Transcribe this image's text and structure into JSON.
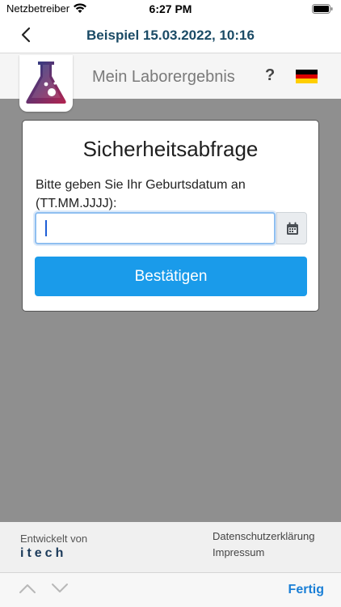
{
  "status_bar": {
    "carrier": "Netzbetreiber",
    "time": "6:27 PM"
  },
  "nav": {
    "title": "Beispiel 15.03.2022, 10:16"
  },
  "header": {
    "app_title": "Mein Laborergebnis",
    "help": "?"
  },
  "dialog": {
    "title": "Sicherheitsabfrage",
    "label": "Bitte geben Sie Ihr Geburtsdatum an (TT.MM.JJJJ):",
    "input_value": "",
    "confirm_label": "Bestätigen"
  },
  "footer": {
    "developed_by": "Entwickelt von",
    "developer_logo": "itech",
    "privacy": "Datenschutzerklärung",
    "imprint": "Impressum"
  },
  "keyboard_toolbar": {
    "done": "Fertig"
  },
  "colors": {
    "nav_title": "#1b4b66",
    "confirm_button": "#1a9bea",
    "done_text": "#1a7fd6",
    "overlay": "#8f8f8f"
  },
  "icons": [
    "wifi-icon",
    "battery-icon",
    "back-chevron-icon",
    "flask-logo-icon",
    "help-icon",
    "german-flag-icon",
    "calendar-icon",
    "chevron-up-icon",
    "chevron-down-icon"
  ]
}
